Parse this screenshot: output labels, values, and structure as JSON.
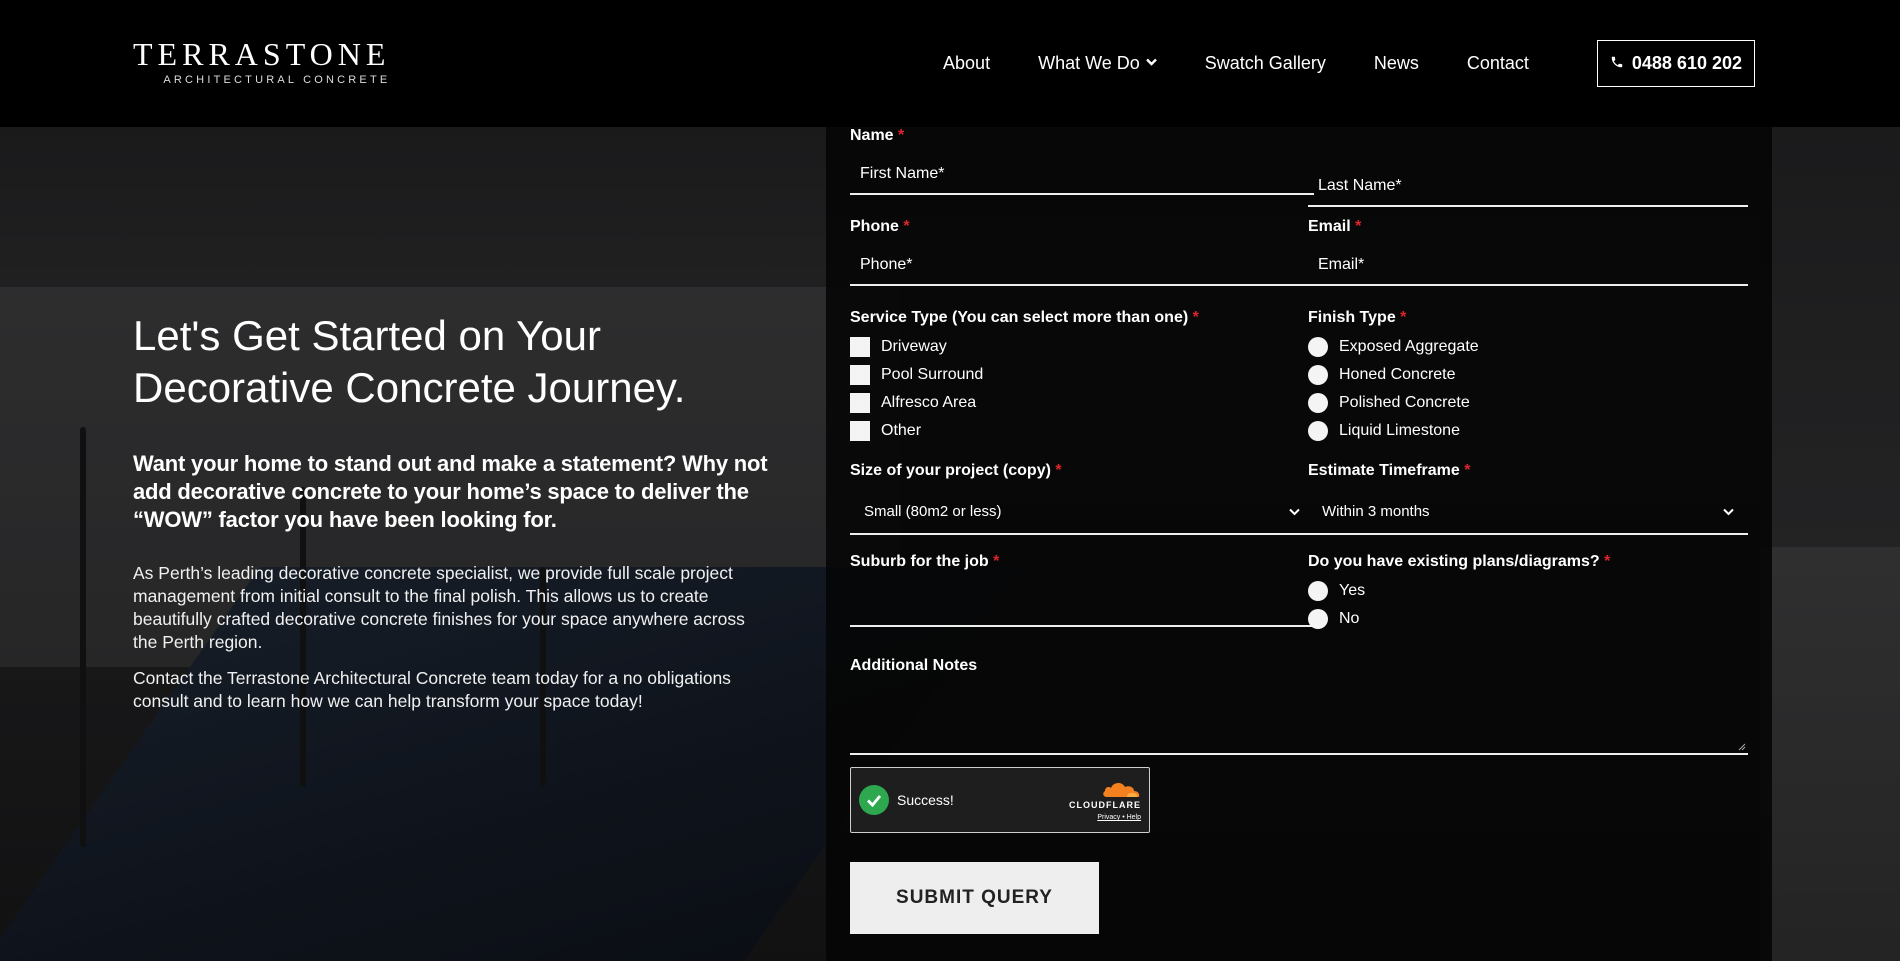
{
  "brand": {
    "name": "TERRASTONE",
    "tagline": "ARCHITECTURAL CONCRETE"
  },
  "nav": {
    "items": [
      {
        "label": "About"
      },
      {
        "label": "What We Do"
      },
      {
        "label": "Swatch Gallery"
      },
      {
        "label": "News"
      },
      {
        "label": "Contact"
      }
    ],
    "phone": "0488 610 202"
  },
  "intro": {
    "heading": "Let's Get Started on Your Decorative Concrete Journey.",
    "lead": "Want your home to stand out and make a statement? Why not add decorative concrete to your home’s space to deliver the “WOW” factor you have been looking for.",
    "paragraphs": [
      "As Perth’s leading decorative concrete specialist, we provide full scale project management from initial consult to the final polish. This allows us to create beautifully crafted decorative concrete finishes for your space anywhere across the Perth region.",
      "Contact the Terrastone Architectural Concrete team today for a no obligations consult and to learn how we can help transform your space today!"
    ]
  },
  "form": {
    "required_mark": "*",
    "name": {
      "label": "Name",
      "first_placeholder": "First Name*",
      "last_placeholder": "Last Name*"
    },
    "phone": {
      "label": "Phone",
      "placeholder": "Phone*"
    },
    "email": {
      "label": "Email",
      "placeholder": "Email*"
    },
    "service_type": {
      "label": "Service Type (You can select more than one)",
      "options": [
        "Driveway",
        "Pool Surround",
        "Alfresco Area",
        "Other"
      ]
    },
    "finish_type": {
      "label": "Finish Type",
      "options": [
        "Exposed Aggregate",
        "Honed Concrete",
        "Polished Concrete",
        "Liquid Limestone"
      ]
    },
    "size": {
      "label": "Size of your project (copy)",
      "value": "Small (80m2 or less)"
    },
    "timeframe": {
      "label": "Estimate Timeframe",
      "value": "Within 3 months"
    },
    "suburb": {
      "label": "Suburb for the job",
      "value": ""
    },
    "plans": {
      "label": "Do you have existing plans/diagrams?",
      "options": [
        "Yes",
        "No"
      ]
    },
    "notes": {
      "label": "Additional Notes",
      "value": ""
    },
    "captcha": {
      "status": "Success!",
      "brand": "CLOUDFLARE",
      "links": "Privacy • Help",
      "accent": "#f48120",
      "success_color": "#2ea84f"
    },
    "submit_label": "SUBMIT QUERY"
  },
  "colors": {
    "accent_required": "#e0242b",
    "header_bg": "#000000",
    "submit_bg": "#eeeeee"
  }
}
